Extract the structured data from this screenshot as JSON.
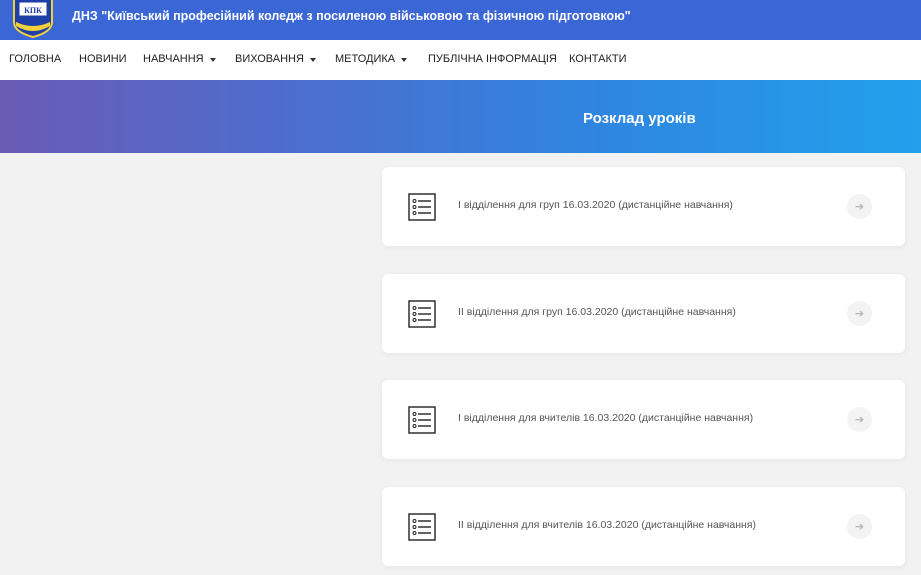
{
  "header": {
    "site_title": "ДНЗ \"Київський професійний коледж з посиленою військовою та фізичною підготовкою\"",
    "logo_text": "КПК"
  },
  "nav": {
    "items": [
      {
        "label": "ГОЛОВНА",
        "dropdown": false
      },
      {
        "label": "НОВИНИ",
        "dropdown": false
      },
      {
        "label": "НАВЧАННЯ",
        "dropdown": true
      },
      {
        "label": "ВИХОВАННЯ",
        "dropdown": true
      },
      {
        "label": "МЕТОДИКА",
        "dropdown": true
      },
      {
        "label": "ПУБЛІЧНА ІНФОРМАЦІЯ",
        "dropdown": false
      },
      {
        "label": "КОНТАКТИ",
        "dropdown": false
      }
    ]
  },
  "banner": {
    "title": "Розклад уроків"
  },
  "documents": [
    {
      "title": "І відділення для груп 16.03.2020 (дистанційне навчання)",
      "icon": "list-document-icon",
      "action_icon": "arrow-right-icon"
    },
    {
      "title": "ІІ відділення для груп 16.03.2020 (дистанційне навчання)",
      "icon": "list-document-icon",
      "action_icon": "arrow-right-icon"
    },
    {
      "title": "І відділення для вчителів 16.03.2020 (дистанційне навчання)",
      "icon": "list-document-icon",
      "action_icon": "arrow-right-icon"
    },
    {
      "title": "ІІ відділення для вчителів 16.03.2020 (дистанційне навчання)",
      "icon": "list-document-icon",
      "action_icon": "arrow-right-icon"
    }
  ],
  "colors": {
    "header_bg": "#3a66d6",
    "banner_gradient_start": "#6a5bb5",
    "banner_gradient_end": "#22a0ec",
    "page_bg": "#f2f2f2"
  }
}
